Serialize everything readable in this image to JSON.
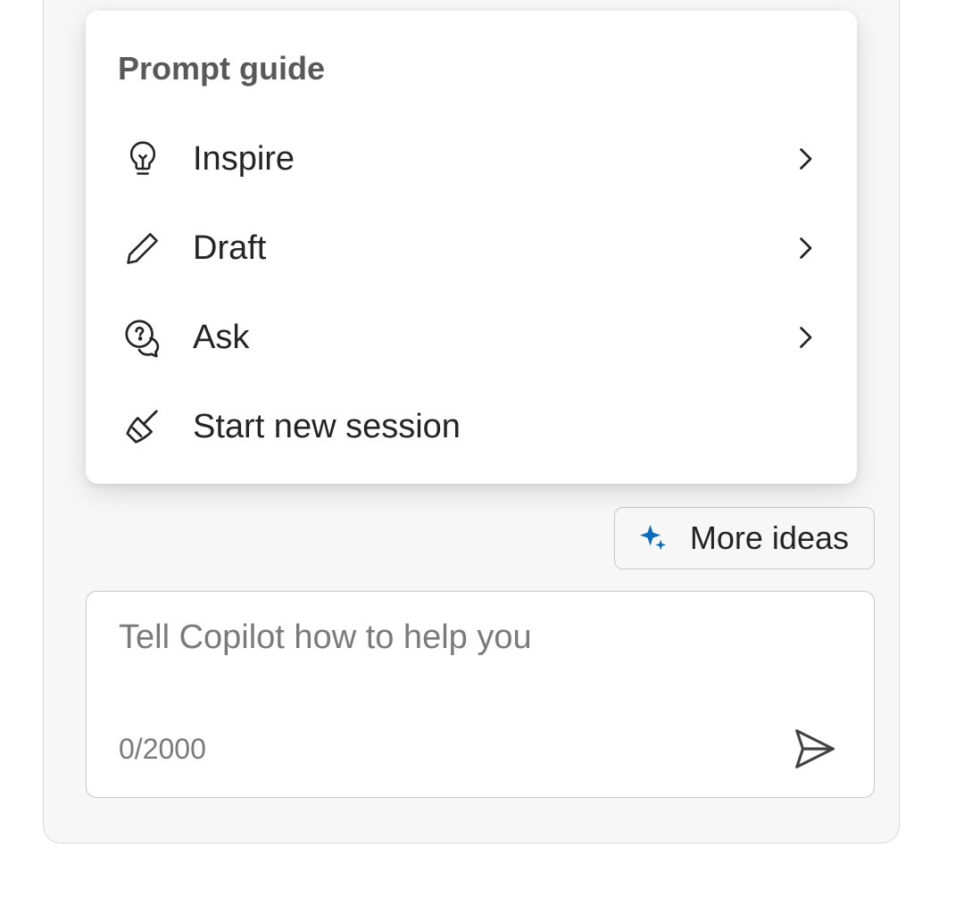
{
  "popup": {
    "title": "Prompt guide",
    "items": [
      {
        "label": "Inspire",
        "icon": "lightbulb-icon",
        "has_chevron": true
      },
      {
        "label": "Draft",
        "icon": "pencil-icon",
        "has_chevron": true
      },
      {
        "label": "Ask",
        "icon": "chat-question-icon",
        "has_chevron": true
      },
      {
        "label": "Start new session",
        "icon": "broom-icon",
        "has_chevron": false
      }
    ]
  },
  "more_ideas": {
    "label": "More ideas"
  },
  "compose": {
    "placeholder": "Tell Copilot how to help you",
    "char_count": "0/2000"
  },
  "colors": {
    "accent": "#0f6cbd",
    "text_primary": "#242424",
    "text_secondary": "#7a7a7a",
    "panel_bg": "#f7f7f7",
    "border": "#c9c9c9"
  }
}
